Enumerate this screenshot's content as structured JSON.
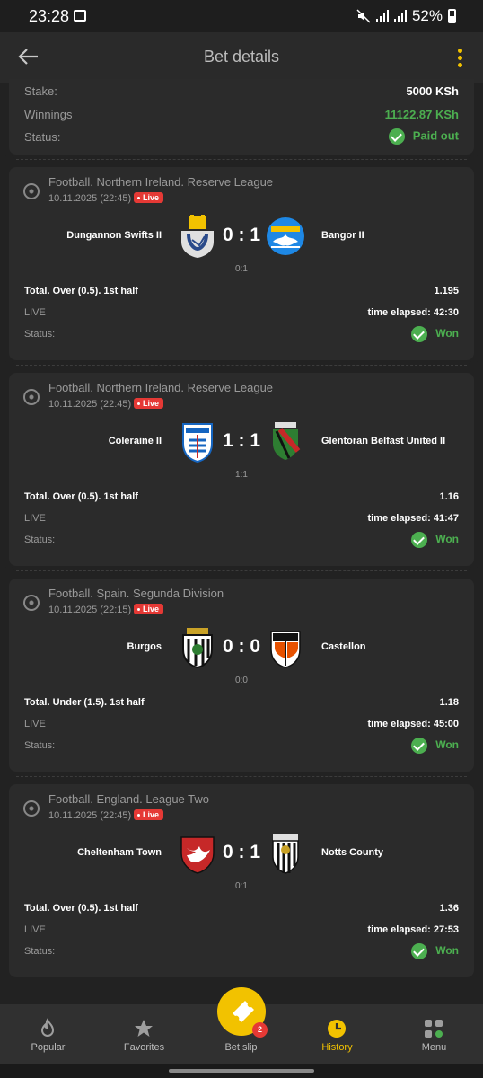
{
  "statusbar": {
    "time": "23:28",
    "battery": "52%"
  },
  "header": {
    "title": "Bet details"
  },
  "summary": {
    "stake_label": "Stake:",
    "stake_value": "5000 KSh",
    "winnings_label": "Winnings",
    "winnings_value": "11122.87 KSh",
    "status_label": "Status:",
    "status_value": "Paid out"
  },
  "bets": [
    {
      "league": "Football. Northern Ireland. Reserve League",
      "date": "10.11.2025 (22:45)",
      "live": "Live",
      "team1": "Dungannon Swifts II",
      "team2": "Bangor II",
      "score": "0 : 1",
      "half_score": "0:1",
      "market": "Total. Over (0.5). 1st half",
      "odds": "1.195",
      "live_label": "LIVE",
      "elapsed": "time elapsed: 42:30",
      "status_label": "Status:",
      "status": "Won"
    },
    {
      "league": "Football. Northern Ireland. Reserve League",
      "date": "10.11.2025 (22:45)",
      "live": "Live",
      "team1": "Coleraine II",
      "team2": "Glentoran Belfast United II",
      "score": "1 : 1",
      "half_score": "1:1",
      "market": "Total. Over (0.5). 1st half",
      "odds": "1.16",
      "live_label": "LIVE",
      "elapsed": "time elapsed: 41:47",
      "status_label": "Status:",
      "status": "Won"
    },
    {
      "league": "Football. Spain. Segunda Division",
      "date": "10.11.2025 (22:15)",
      "live": "Live",
      "team1": "Burgos",
      "team2": "Castellon",
      "score": "0 : 0",
      "half_score": "0:0",
      "market": "Total. Under (1.5). 1st half",
      "odds": "1.18",
      "live_label": "LIVE",
      "elapsed": "time elapsed: 45:00",
      "status_label": "Status:",
      "status": "Won"
    },
    {
      "league": "Football. England. League Two",
      "date": "10.11.2025 (22:45)",
      "live": "Live",
      "team1": "Cheltenham Town",
      "team2": "Notts County",
      "score": "0 : 1",
      "half_score": "0:1",
      "market": "Total. Over (0.5). 1st half",
      "odds": "1.36",
      "live_label": "LIVE",
      "elapsed": "time elapsed: 27:53",
      "status_label": "Status:",
      "status": "Won"
    }
  ],
  "nav": {
    "popular": "Popular",
    "favorites": "Favorites",
    "betslip": "Bet slip",
    "betslip_count": "2",
    "history": "History",
    "menu": "Menu"
  },
  "colors": {
    "accent": "#f2c200",
    "success": "#4caf50",
    "live": "#e53935"
  }
}
